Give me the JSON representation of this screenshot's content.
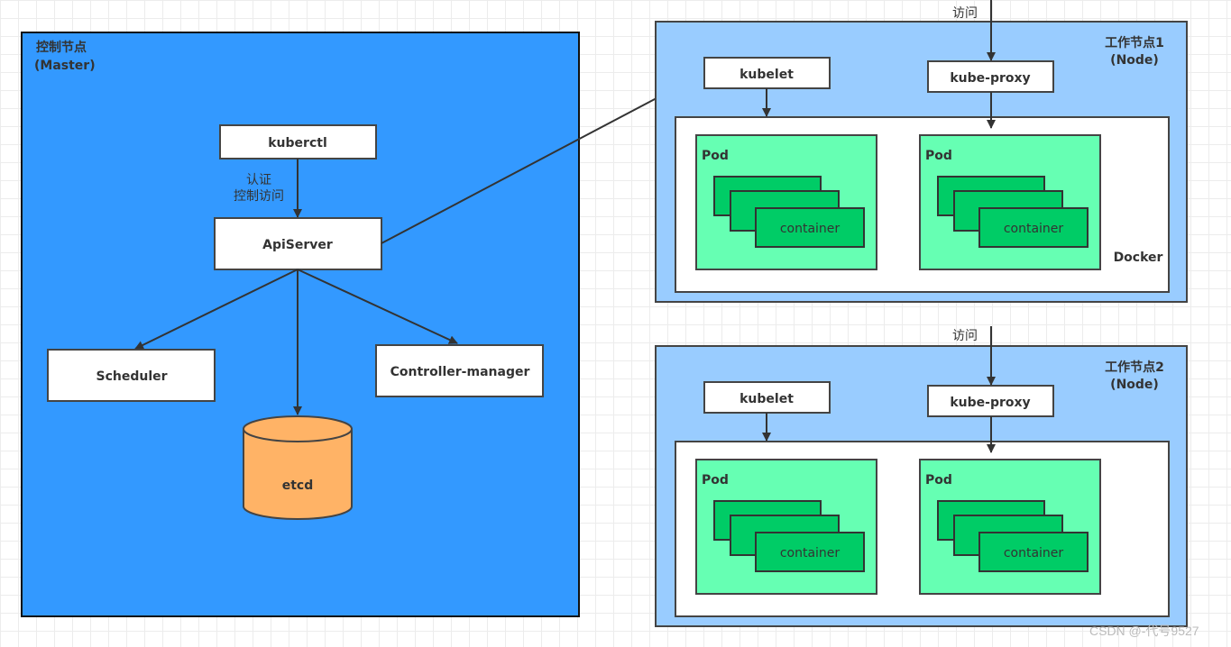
{
  "colors": {
    "master": "#3399ff",
    "node": "#99ccff",
    "pod": "#66ffb3",
    "container": "#00cc66",
    "etcd": "#ffb366",
    "stroke": "#333333"
  },
  "master": {
    "title": "控制节点",
    "subtitle": "(Master)",
    "kuberctl": "kuberctl",
    "auth_label_1": "认证",
    "auth_label_2": "控制访问",
    "apiserver": "ApiServer",
    "scheduler": "Scheduler",
    "controller": "Controller-manager",
    "etcd": "etcd"
  },
  "nodes": [
    {
      "title": "工作节点1",
      "subtitle": "(Node)",
      "access": "访问",
      "kubelet": "kubelet",
      "kube_proxy": "kube-proxy",
      "docker": "Docker",
      "pods": [
        {
          "label": "Pod",
          "container": "container"
        },
        {
          "label": "Pod",
          "container": "container"
        }
      ]
    },
    {
      "title": "工作节点2",
      "subtitle": "(Node)",
      "access": "访问",
      "kubelet": "kubelet",
      "kube_proxy": "kube-proxy",
      "docker": "",
      "pods": [
        {
          "label": "Pod",
          "container": "container"
        },
        {
          "label": "Pod",
          "container": "container"
        }
      ]
    }
  ],
  "watermark": "CSDN @-代号9527"
}
